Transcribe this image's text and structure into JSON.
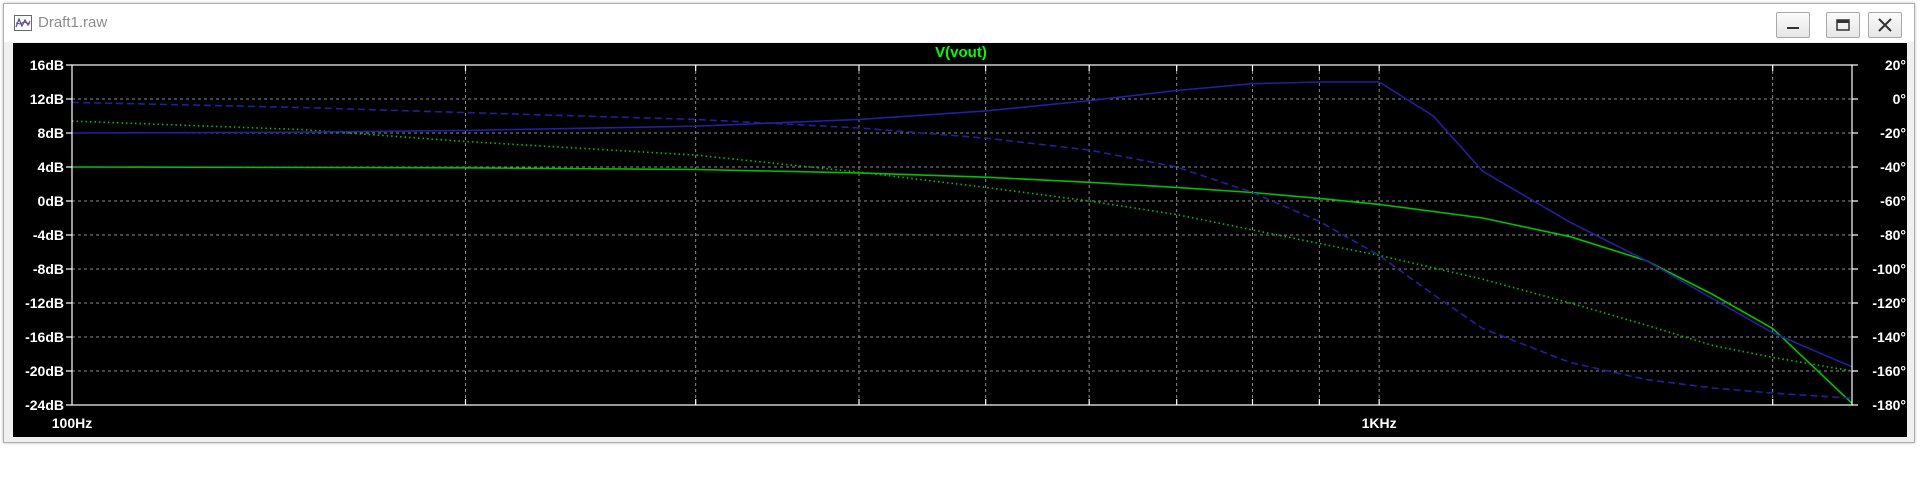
{
  "window": {
    "title": "Draft1.raw",
    "icon": "waveform-app-icon",
    "controls": [
      "minimize-icon",
      "restore-icon",
      "close-icon"
    ]
  },
  "colors": {
    "background": "#000000",
    "axis": "#ffffff",
    "grid": "#8c8c8c",
    "trace_title": "#00ff00"
  },
  "chart_data": {
    "type": "line",
    "title": "V(vout)",
    "x_scale": "log",
    "xlim": [
      100,
      2300
    ],
    "x_tick_labels": [
      {
        "value": 100,
        "label": "100Hz"
      },
      {
        "value": 1000,
        "label": "1KHz"
      }
    ],
    "x_minor_ticks": [
      200,
      300,
      400,
      500,
      600,
      700,
      800,
      900,
      2000
    ],
    "left_axis": {
      "unit": "dB",
      "ylim": [
        -24,
        16
      ],
      "ticks": [
        16,
        12,
        8,
        4,
        0,
        -4,
        -8,
        -12,
        -16,
        -20,
        -24
      ],
      "tick_labels": [
        "16dB",
        "12dB",
        "8dB",
        "4dB",
        "0dB",
        "-4dB",
        "-8dB",
        "-12dB",
        "-16dB",
        "-20dB",
        "-24dB"
      ]
    },
    "right_axis": {
      "unit": "degrees",
      "ylim": [
        -180,
        20
      ],
      "ticks": [
        20,
        0,
        -20,
        -40,
        -60,
        -80,
        -100,
        -120,
        -140,
        -160,
        -180
      ],
      "tick_labels": [
        "20°",
        "0°",
        "-20°",
        "-40°",
        "-60°",
        "-80°",
        "-100°",
        "-120°",
        "-140°",
        "-160°",
        "-180°"
      ]
    },
    "grid": true,
    "series": [
      {
        "color": "#00c000",
        "style": "solid",
        "axis": "left",
        "x": [
          100,
          200,
          300,
          400,
          500,
          600,
          700,
          800,
          900,
          1000,
          1200,
          1400,
          1600,
          1800,
          2000,
          2300
        ],
        "y": [
          4,
          3.9,
          3.7,
          3.3,
          2.8,
          2.2,
          1.6,
          1.0,
          0.3,
          -0.4,
          -2.0,
          -4.2,
          -7.0,
          -11.0,
          -15.0,
          -23.8
        ]
      },
      {
        "color": "#00c000",
        "style": "dotted",
        "axis": "right",
        "x": [
          100,
          150,
          200,
          300,
          400,
          500,
          600,
          700,
          800,
          900,
          1000,
          1200,
          1400,
          1600,
          1800,
          2000,
          2300
        ],
        "y": [
          -13,
          -18,
          -25,
          -33,
          -43,
          -52,
          -60,
          -68,
          -77,
          -85,
          -92,
          -106,
          -120,
          -133,
          -145,
          -152,
          -160
        ]
      },
      {
        "color": "#2020a0",
        "style": "solid",
        "axis": "left",
        "x": [
          100,
          150,
          200,
          300,
          400,
          500,
          600,
          700,
          800,
          900,
          1000,
          1100,
          1200,
          1400,
          1600,
          1800,
          2000,
          2300
        ],
        "y": [
          8,
          8.1,
          8.3,
          8.8,
          9.6,
          10.6,
          11.8,
          13.0,
          13.8,
          14.0,
          14.0,
          10.0,
          3.5,
          -2.5,
          -7.0,
          -11.5,
          -15.5,
          -19.5
        ]
      },
      {
        "color": "#2020a0",
        "style": "dashed",
        "axis": "right",
        "x": [
          100,
          150,
          200,
          300,
          400,
          500,
          600,
          700,
          800,
          900,
          1000,
          1100,
          1200,
          1400,
          1600,
          1800,
          2000,
          2300
        ],
        "y": [
          -2,
          -5,
          -8,
          -12,
          -17,
          -23,
          -30,
          -40,
          -55,
          -72,
          -92,
          -115,
          -135,
          -155,
          -165,
          -170,
          -173,
          -176
        ]
      }
    ]
  }
}
